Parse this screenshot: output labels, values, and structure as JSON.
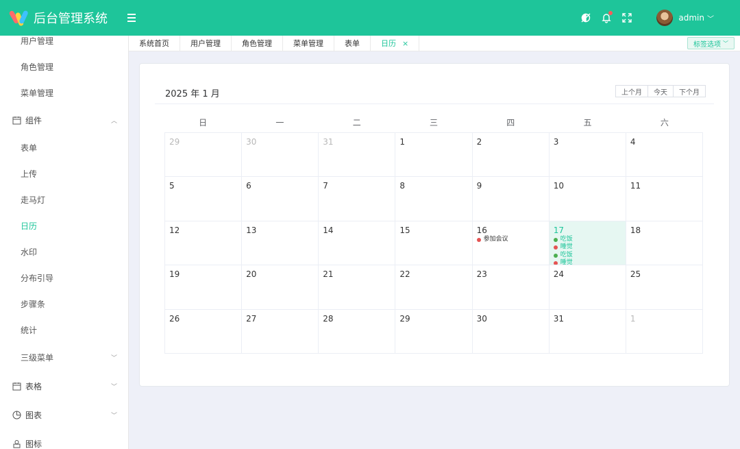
{
  "app": {
    "title": "后台管理系统"
  },
  "header": {
    "user_name": "admin"
  },
  "sidebar": {
    "items_top": [
      {
        "label": "用户管理"
      },
      {
        "label": "角色管理"
      },
      {
        "label": "菜单管理"
      }
    ],
    "components_group": {
      "label": "组件"
    },
    "components": [
      {
        "label": "表单"
      },
      {
        "label": "上传"
      },
      {
        "label": "走马灯"
      },
      {
        "label": "日历",
        "active": true
      },
      {
        "label": "水印"
      },
      {
        "label": "分布引导"
      },
      {
        "label": "步骤条"
      },
      {
        "label": "统计"
      }
    ],
    "submenu": {
      "label": "三级菜单"
    },
    "groups_bottom": [
      {
        "label": "表格"
      },
      {
        "label": "图表"
      },
      {
        "label": "图标"
      }
    ]
  },
  "tabs": [
    {
      "label": "系统首页"
    },
    {
      "label": "用户管理"
    },
    {
      "label": "角色管理"
    },
    {
      "label": "菜单管理"
    },
    {
      "label": "表单"
    },
    {
      "label": "日历",
      "active": true,
      "close": "×"
    }
  ],
  "tab_options": {
    "label": "标签选项"
  },
  "calendar": {
    "title": "2025 年 1 月",
    "buttons": {
      "prev": "上个月",
      "today": "今天",
      "next": "下个月"
    },
    "weekdays": [
      "日",
      "一",
      "二",
      "三",
      "四",
      "五",
      "六"
    ],
    "days": [
      {
        "n": "29",
        "dim": true
      },
      {
        "n": "30",
        "dim": true
      },
      {
        "n": "31",
        "dim": true
      },
      {
        "n": "1"
      },
      {
        "n": "2"
      },
      {
        "n": "3"
      },
      {
        "n": "4"
      },
      {
        "n": "5"
      },
      {
        "n": "6"
      },
      {
        "n": "7"
      },
      {
        "n": "8"
      },
      {
        "n": "9"
      },
      {
        "n": "10"
      },
      {
        "n": "11"
      },
      {
        "n": "12"
      },
      {
        "n": "13"
      },
      {
        "n": "14"
      },
      {
        "n": "15"
      },
      {
        "n": "16",
        "events": [
          {
            "text": "参加会议",
            "color": "#e55353"
          }
        ]
      },
      {
        "n": "17",
        "today": true,
        "events": [
          {
            "text": "吃饭",
            "color": "#4caf50"
          },
          {
            "text": "睡觉",
            "color": "#e55353"
          },
          {
            "text": "吃饭",
            "color": "#4caf50"
          },
          {
            "text": "睡觉",
            "color": "#e55353"
          }
        ]
      },
      {
        "n": "18"
      },
      {
        "n": "19"
      },
      {
        "n": "20"
      },
      {
        "n": "21"
      },
      {
        "n": "22"
      },
      {
        "n": "23"
      },
      {
        "n": "24"
      },
      {
        "n": "25"
      },
      {
        "n": "26"
      },
      {
        "n": "27"
      },
      {
        "n": "28"
      },
      {
        "n": "29"
      },
      {
        "n": "30"
      },
      {
        "n": "31"
      },
      {
        "n": "1",
        "dim": true
      }
    ]
  },
  "colors": {
    "accent": "#1ec59a",
    "event_red": "#e55353",
    "event_green": "#4caf50"
  }
}
